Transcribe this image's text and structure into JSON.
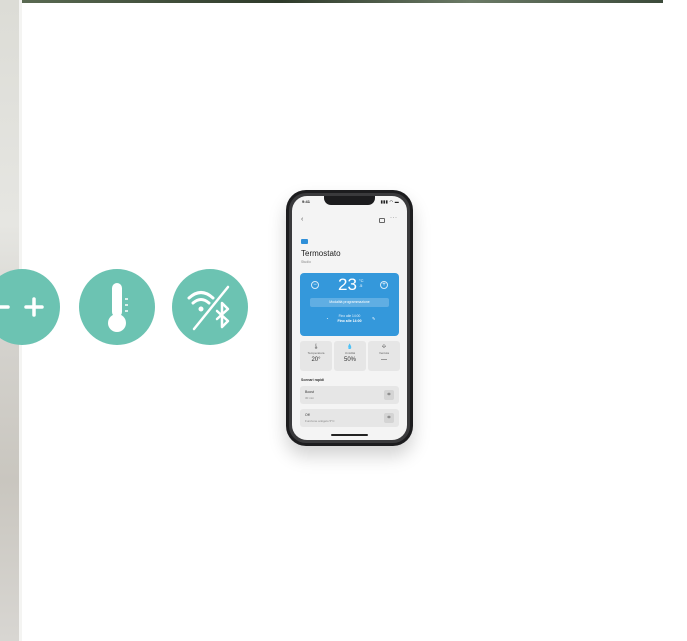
{
  "features": {
    "icons": [
      "plus-minus-icon",
      "thermometer-icon",
      "wifi-bluetooth-off-icon"
    ],
    "color": "#6cc3b2",
    "plus_glyph": "+",
    "minus_glyph": "−"
  },
  "phone": {
    "status": {
      "time": "9:41",
      "indicators": "▮▮▮ ◠ ▬"
    },
    "nav": {
      "back": "‹",
      "more": "···"
    },
    "device": {
      "title": "Termostato",
      "room": "Studio"
    },
    "temp_card": {
      "minus": "−",
      "plus": "+",
      "temperature": "23",
      "unit_top": "°C",
      "unit_bottom": ".5",
      "button": "Modalità programmazione",
      "line1": "Fino alle 14:00",
      "line2": "Fino alle 14:00",
      "accent": "#3498db"
    },
    "tiles": [
      {
        "icon": "🌡",
        "label": "Temperatura",
        "value": "20°"
      },
      {
        "icon": "💧",
        "label": "Umidità",
        "value": "50%"
      },
      {
        "icon": "✣",
        "label": "Ventola",
        "value": "—"
      }
    ],
    "section_title": "Scenari rapidi",
    "rows": [
      {
        "title": "Boost",
        "subtitle": "30 min",
        "icon": "⌗"
      },
      {
        "title": "Off",
        "subtitle": "Funzione antigelo 5°C",
        "icon": "⌗"
      }
    ]
  }
}
